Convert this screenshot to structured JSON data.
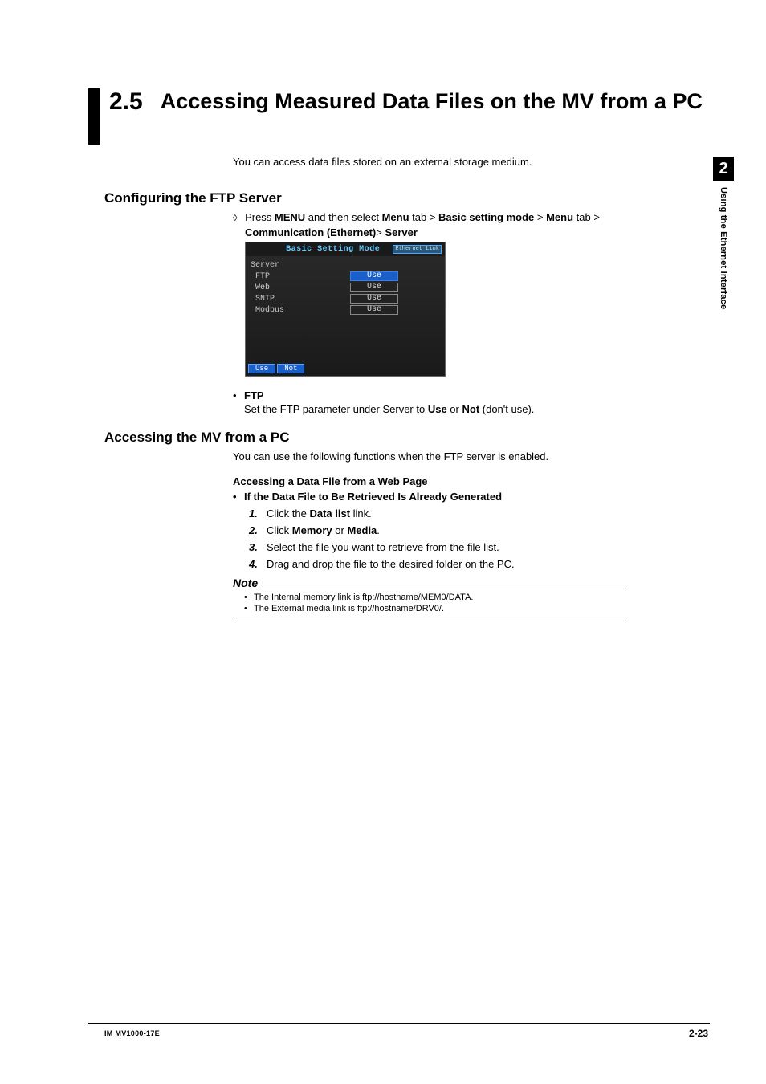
{
  "side": {
    "chapter_num": "2",
    "chapter_text": "Using the Ethernet Interface"
  },
  "title": {
    "num": "2.5",
    "text": "Accessing Measured Data Files on the MV from a PC"
  },
  "intro": "You can access data files stored on an external storage medium.",
  "section1": {
    "heading": "Configuring the FTP Server",
    "press_prefix": "Press ",
    "press_menu": "MENU",
    "press_mid": " and then select ",
    "c1": "Menu",
    "c1s": " tab > ",
    "c2": "Basic setting mode",
    "c2s": " > ",
    "c3": "Menu",
    "c3s": " tab > ",
    "c4": "Communication (Ethernet)",
    "c4s": "> ",
    "c5": "Server"
  },
  "device": {
    "title": "Basic Setting Mode",
    "badge": "Ethernet Link",
    "group": "Server",
    "rows": [
      {
        "label": "FTP",
        "value": "Use",
        "selected": true
      },
      {
        "label": "Web",
        "value": "Use",
        "selected": false
      },
      {
        "label": "SNTP",
        "value": "Use",
        "selected": false
      },
      {
        "label": "Modbus",
        "value": "Use",
        "selected": false
      }
    ],
    "btn1": "Use",
    "btn2": "Not"
  },
  "ftp": {
    "head": "FTP",
    "text_a": "Set the FTP parameter under Server to ",
    "use": "Use",
    "or": " or ",
    "not": "Not",
    "tail": " (don't use)."
  },
  "section2": {
    "heading": "Accessing the MV from a PC",
    "intro": "You can use the following functions when the FTP server is enabled.",
    "sub": "Accessing a Data File from a Web Page",
    "cond": "If the Data File to Be Retrieved Is Already Generated",
    "steps": {
      "s1a": "Click the ",
      "s1b": "Data list",
      "s1c": " link.",
      "s2a": "Click ",
      "s2b": "Memory",
      "s2c": " or ",
      "s2d": "Media",
      "s2e": ".",
      "s3": "Select the file you want to retrieve from the file list.",
      "s4": "Drag and drop the file to the desired folder on the PC."
    },
    "note_title": "Note",
    "note1": "The Internal memory link is ftp://hostname/MEM0/DATA.",
    "note2": "The External media link is ftp://hostname/DRV0/."
  },
  "footer": {
    "left": "IM MV1000-17E",
    "right": "2-23"
  }
}
